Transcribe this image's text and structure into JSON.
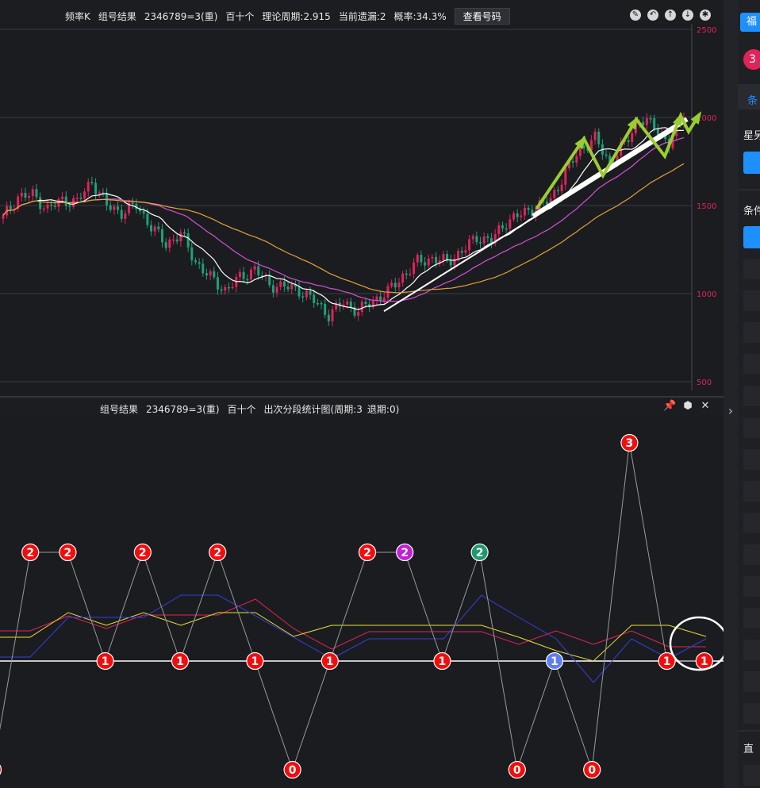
{
  "top_panel": {
    "title": "频率K",
    "subtitle": "组号结果",
    "combo": "2346789=3(重)",
    "position": "百十个",
    "theory_period": "理论周期:2.915",
    "current_miss": "当前遗漏:2",
    "probability": "概率:34.3%",
    "view_button": "查看号码",
    "y_ticks": [
      "2500",
      "2000",
      "1500",
      "1000",
      "500"
    ],
    "icons": [
      "edit-icon",
      "undo-icon",
      "up-icon",
      "down-icon",
      "settings-icon"
    ]
  },
  "bottom_panel": {
    "subtitle": "组号结果",
    "combo": "2346789=3(重)",
    "position": "百十个",
    "chart_name": "出次分段统计图(周期:3",
    "back_period": "退期:0)",
    "icons": [
      "pin-icon",
      "settings-icon",
      "close-icon"
    ]
  },
  "sidebar": {
    "tab_label": "福",
    "badge": "3",
    "tab2": "条",
    "section1": "星另",
    "section2": "条件",
    "section3": "直"
  },
  "colors": {
    "background": "#1b1c20",
    "up_candle": "#e0235a",
    "down_candle": "#1fa07a",
    "ma_white": "#ffffff",
    "ma_magenta": "#d94fd6",
    "ma_orange": "#e1a23a",
    "arrow": "#9acd32",
    "accent": "#1e8fff"
  },
  "chart_data": [
    {
      "type": "candlestick",
      "title": "频率K",
      "y_axis": {
        "ticks": [
          2500,
          2000,
          1500,
          1000,
          500
        ],
        "range": [
          500,
          2500
        ],
        "position": "right"
      },
      "grid": true,
      "overlays": [
        "MA white",
        "MA magenta",
        "MA orange",
        "trend lines",
        "green zigzag arrows"
      ],
      "close_trajectory": [
        1430,
        1550,
        1560,
        1480,
        1530,
        1520,
        1640,
        1500,
        1460,
        1500,
        1380,
        1280,
        1340,
        1180,
        1090,
        1020,
        1090,
        1140,
        1050,
        1040,
        1020,
        960,
        880,
        950,
        900,
        960,
        1010,
        1100,
        1180,
        1200,
        1180,
        1240,
        1320,
        1300,
        1410,
        1450,
        1490,
        1530,
        1690,
        1820,
        1880,
        1740,
        1850,
        1990,
        1950,
        1850,
        2000
      ],
      "sampled_every_candles": 4
    },
    {
      "type": "line",
      "title": "出次分段统计图(周期:3",
      "x_count": 20,
      "main_series": [
        0,
        2,
        2,
        1,
        2,
        1,
        2,
        1,
        0,
        1,
        2,
        2,
        1,
        2,
        0,
        1,
        0,
        3,
        1,
        1
      ],
      "main_series_badge_colors": [
        "red",
        "red",
        "red",
        "red",
        "red",
        "red",
        "red",
        "red",
        "red",
        "red",
        "red",
        "purple",
        "red",
        "teal",
        "red",
        "blue",
        "red",
        "red",
        "red",
        "red"
      ],
      "extra_series": [
        "red-line",
        "yellow-line",
        "blue-line"
      ],
      "baseline": 1
    }
  ]
}
